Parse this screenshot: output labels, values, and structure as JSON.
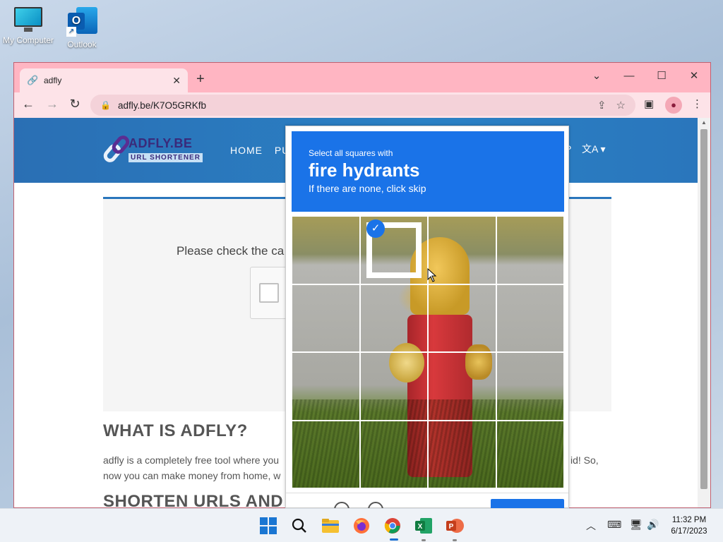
{
  "desktop": {
    "icons": [
      {
        "label": "My Computer",
        "icon": "computer-icon"
      },
      {
        "label": "Outlook",
        "icon": "outlook-icon"
      }
    ]
  },
  "browser": {
    "tab": {
      "title": "adfly",
      "icon": "link-icon"
    },
    "new_tab_label": "+",
    "window_controls": {
      "dropdown": "⌄",
      "minimize": "—",
      "maximize": "☐",
      "close": "✕"
    },
    "address": {
      "url": "adfly.be/K7O5GRKfb"
    }
  },
  "site": {
    "logo": {
      "brand": "ADFLY.BE",
      "tagline": "URL SHORTENER"
    },
    "menu": [
      "HOME",
      "PU"
    ],
    "menu_right": "P",
    "check_prompt": "Please check the ca",
    "what_heading": "WHAT IS ADFLY?",
    "what_line1": "adfly is a completely free tool where you",
    "what_line1_tail": "id! So,",
    "what_line2": "now you can make money from home, w",
    "shorten_heading": "SHORTEN URLS AND"
  },
  "captcha": {
    "instruction_line1": "Select all squares with",
    "target": "fire hydrants",
    "instruction_line3": "If there are none, click skip",
    "selected_tiles": [
      1
    ]
  },
  "taskbar": {
    "apps": [
      "start",
      "search",
      "file-explorer",
      "firefox",
      "chrome",
      "excel",
      "powerpoint"
    ],
    "active_app": "chrome",
    "time": "11:32 PM",
    "date": "6/17/2023"
  }
}
